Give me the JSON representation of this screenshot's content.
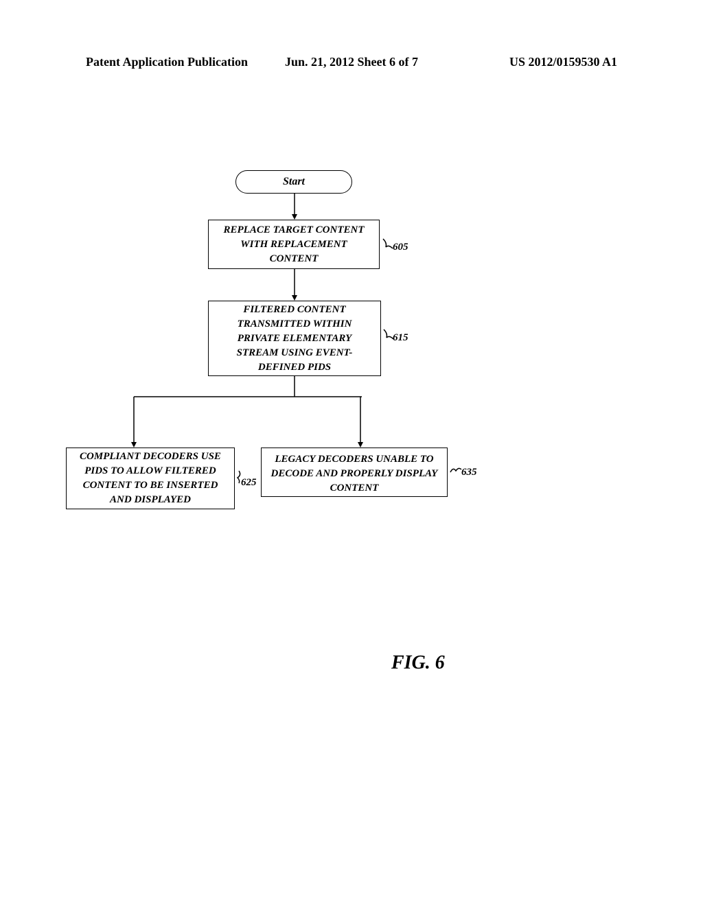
{
  "header": {
    "left": "Patent Application Publication",
    "center": "Jun. 21, 2012  Sheet 6 of 7",
    "right": "US 2012/0159530 A1"
  },
  "chart_data": {
    "type": "flowchart",
    "title": "FIG. 6",
    "nodes": [
      {
        "id": "start",
        "type": "terminator",
        "label": "Start"
      },
      {
        "id": "605",
        "type": "process",
        "label": "REPLACE TARGET CONTENT WITH REPLACEMENT CONTENT",
        "ref": "605"
      },
      {
        "id": "615",
        "type": "process",
        "label": "FILTERED CONTENT TRANSMITTED WITHIN PRIVATE ELEMENTARY STREAM USING EVENT-DEFINED PIDS",
        "ref": "615"
      },
      {
        "id": "625",
        "type": "process",
        "label": "COMPLIANT DECODERS USE PIDS TO ALLOW FILTERED CONTENT TO BE INSERTED AND DISPLAYED",
        "ref": "625"
      },
      {
        "id": "635",
        "type": "process",
        "label": "LEGACY DECODERS UNABLE TO DECODE AND PROPERLY DISPLAY CONTENT",
        "ref": "635"
      }
    ],
    "edges": [
      {
        "from": "start",
        "to": "605"
      },
      {
        "from": "605",
        "to": "615"
      },
      {
        "from": "615",
        "to": "625"
      },
      {
        "from": "615",
        "to": "635"
      }
    ]
  },
  "figure_label": "FIG. 6"
}
